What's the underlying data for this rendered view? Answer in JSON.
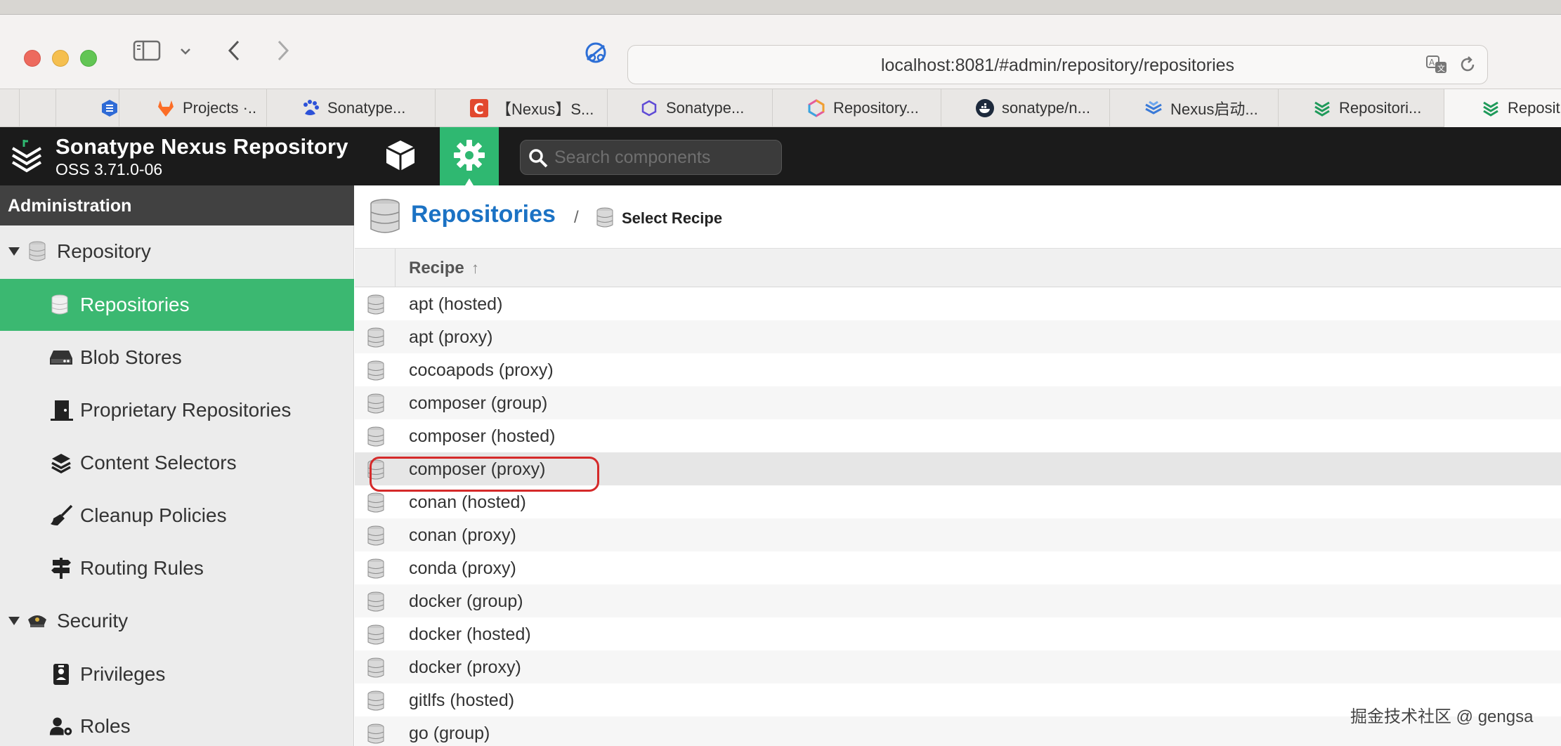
{
  "browser": {
    "address": "localhost:8081/#admin/repository/repositories",
    "tabs": [
      {
        "label": ""
      },
      {
        "label": "Projects ·.."
      },
      {
        "label": "Sonatype..."
      },
      {
        "label": "【Nexus】S..."
      },
      {
        "label": "Sonatype..."
      },
      {
        "label": "Repository..."
      },
      {
        "label": "sonatype/n..."
      },
      {
        "label": "Nexus启动..."
      },
      {
        "label": "Repositori..."
      },
      {
        "label": "Reposit"
      }
    ]
  },
  "app": {
    "title": "Sonatype Nexus Repository",
    "version": "OSS 3.71.0-06",
    "search_placeholder": "Search components",
    "accent": "#3bb871"
  },
  "sidebar": {
    "header": "Administration",
    "groups": [
      {
        "label": "Repository",
        "items": [
          {
            "label": "Repositories",
            "active": true
          },
          {
            "label": "Blob Stores"
          },
          {
            "label": "Proprietary Repositories"
          },
          {
            "label": "Content Selectors"
          },
          {
            "label": "Cleanup Policies"
          },
          {
            "label": "Routing Rules"
          }
        ]
      },
      {
        "label": "Security",
        "items": [
          {
            "label": "Privileges"
          },
          {
            "label": "Roles"
          }
        ]
      }
    ]
  },
  "breadcrumb": {
    "title": "Repositories",
    "separator": "/",
    "current": "Select Recipe"
  },
  "grid": {
    "column": "Recipe",
    "sort_indicator": "↑",
    "rows": [
      "apt (hosted)",
      "apt (proxy)",
      "cocoapods (proxy)",
      "composer (group)",
      "composer (hosted)",
      "composer (proxy)",
      "conan (hosted)",
      "conan (proxy)",
      "conda (proxy)",
      "docker (group)",
      "docker (hosted)",
      "docker (proxy)",
      "gitlfs (hosted)",
      "go (group)"
    ],
    "selected_row": "composer (proxy)"
  },
  "watermark": "掘金技术社区 @ gengsa"
}
